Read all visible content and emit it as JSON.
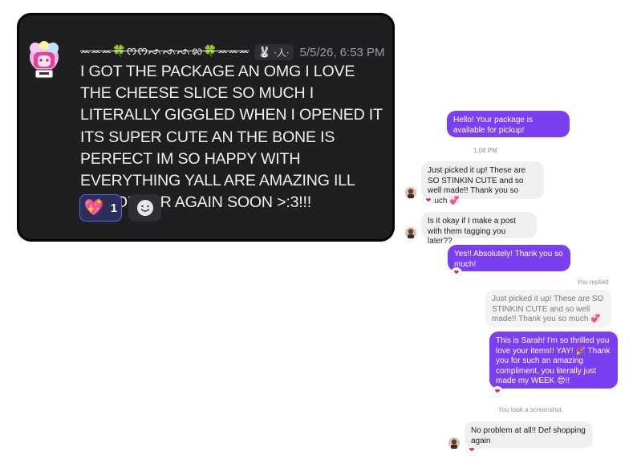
{
  "discord": {
    "username": "ꕀꕀꕀ🍀ᰔᰔᨒᨒᨒ᪙🍀ꕀꕀꕀ",
    "clover": "🍀",
    "role_icon": "🐰",
    "role_text": "·人·",
    "timestamp": "5/5/26, 6:53 PM",
    "message": "I GOT THE PACKAGE AN OMG I LOVE THE CHEESE SLICE SO MUCH I LITERALLY GIGGLED WHEN I OPENED IT ITS SUPER CUTE AN THE BONE IS PERFECT IM SO HAPPY WITH EVERYTHING YALL ARE AMAZING ILL DEF ORDER AGAIN SOON >:3!!!",
    "reaction": {
      "emoji": "💖",
      "count": "1"
    },
    "add_reaction_icon": "smiley-face-icon"
  },
  "chat": {
    "msg1": "Hello! Your package is available for pickup!",
    "time1": "1:08 PM",
    "msg2": "Just picked it up! These are SO STINKIN CUTE and so well made!! Thank you so much 💞",
    "msg3": "Is it okay if I make a post with them tagging you later??",
    "msg4": "Yes!! Absolutely! Thank you so much!",
    "replied_label": "You replied",
    "quoted": "Just picked it up! These are SO STINKIN CUTE and so well made!! Thank you so much 💞",
    "msg5": "This is Sarah! I'm so thrilled you love your items!! YAY! 🎉 Thank you for such an amazing compliment, you literally just made my WEEK 😍!!",
    "screenshot_note": "You took a screenshot.",
    "msg6": "No problem at all!! Def shopping again",
    "reaction_heart": "❤",
    "colors": {
      "outgoing": "#7a3ff0",
      "incoming": "#efeff0"
    }
  }
}
